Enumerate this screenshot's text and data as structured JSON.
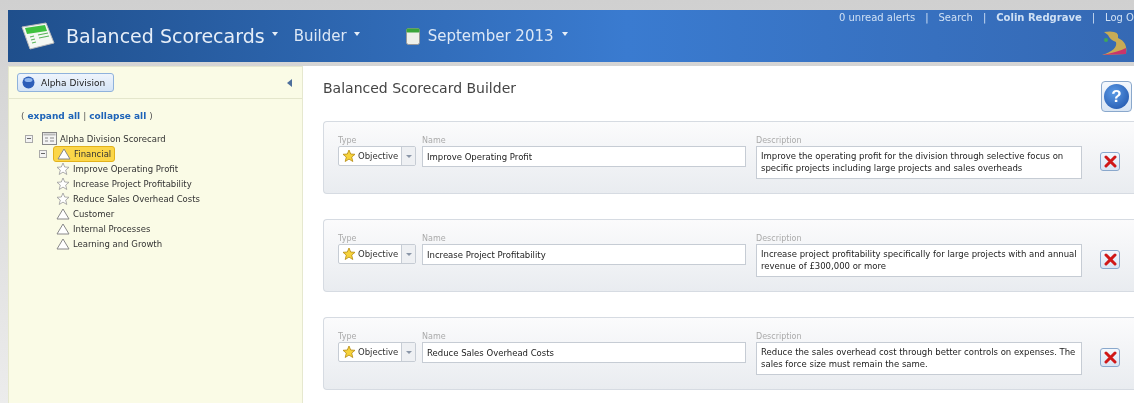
{
  "header": {
    "app_title": "Balanced Scorecards",
    "menu": "Builder",
    "period": "September 2013",
    "links": [
      {
        "label": "0 unread alerts",
        "kind": "link"
      },
      {
        "label": "Search",
        "kind": "link"
      },
      {
        "label": "Colin Redgrave",
        "kind": "user"
      },
      {
        "label": "Log O",
        "kind": "link"
      }
    ],
    "link_separator": "|"
  },
  "sidebar": {
    "division_button": "Alpha Division",
    "expand_all": "expand all",
    "collapse_all": "collapse all",
    "open_paren": "(",
    "separator": "|",
    "close_paren": ")",
    "tree": [
      {
        "label": "Alpha Division Scorecard",
        "kind": "scorecard",
        "selected": false,
        "expanded": true,
        "children": [
          {
            "label": "Financial",
            "kind": "perspective",
            "selected": true,
            "expanded": true,
            "children": [
              {
                "label": "Improve Operating Profit",
                "kind": "objective",
                "selected": false
              },
              {
                "label": "Increase Project Profitability",
                "kind": "objective",
                "selected": false
              },
              {
                "label": "Reduce Sales Overhead Costs",
                "kind": "objective",
                "selected": false
              }
            ]
          },
          {
            "label": "Customer",
            "kind": "perspective",
            "selected": false
          },
          {
            "label": "Internal Processes",
            "kind": "perspective",
            "selected": false
          },
          {
            "label": "Learning and Growth",
            "kind": "perspective",
            "selected": false
          }
        ]
      }
    ]
  },
  "main": {
    "title": "Balanced Scorecard Builder",
    "help_icon": "?",
    "items": [
      {
        "type_label": "Type",
        "type": "Objective",
        "name_label": "Name",
        "name": "Improve Operating Profit",
        "description_label": "Description",
        "description": "Improve the operating profit for the division through selective focus on specific projects including large projects and sales overheads"
      },
      {
        "type_label": "Type",
        "type": "Objective",
        "name_label": "Name",
        "name": "Increase Project Profitability",
        "description_label": "Description",
        "description": "Increase project profitability specifically for large projects with and annual revenue of £300,000 or more"
      },
      {
        "type_label": "Type",
        "type": "Objective",
        "name_label": "Name",
        "name": "Reduce Sales Overhead Costs",
        "description_label": "Description",
        "description": "Reduce the sales overhead cost through better controls on expenses. The sales force size must remain the same."
      }
    ]
  }
}
